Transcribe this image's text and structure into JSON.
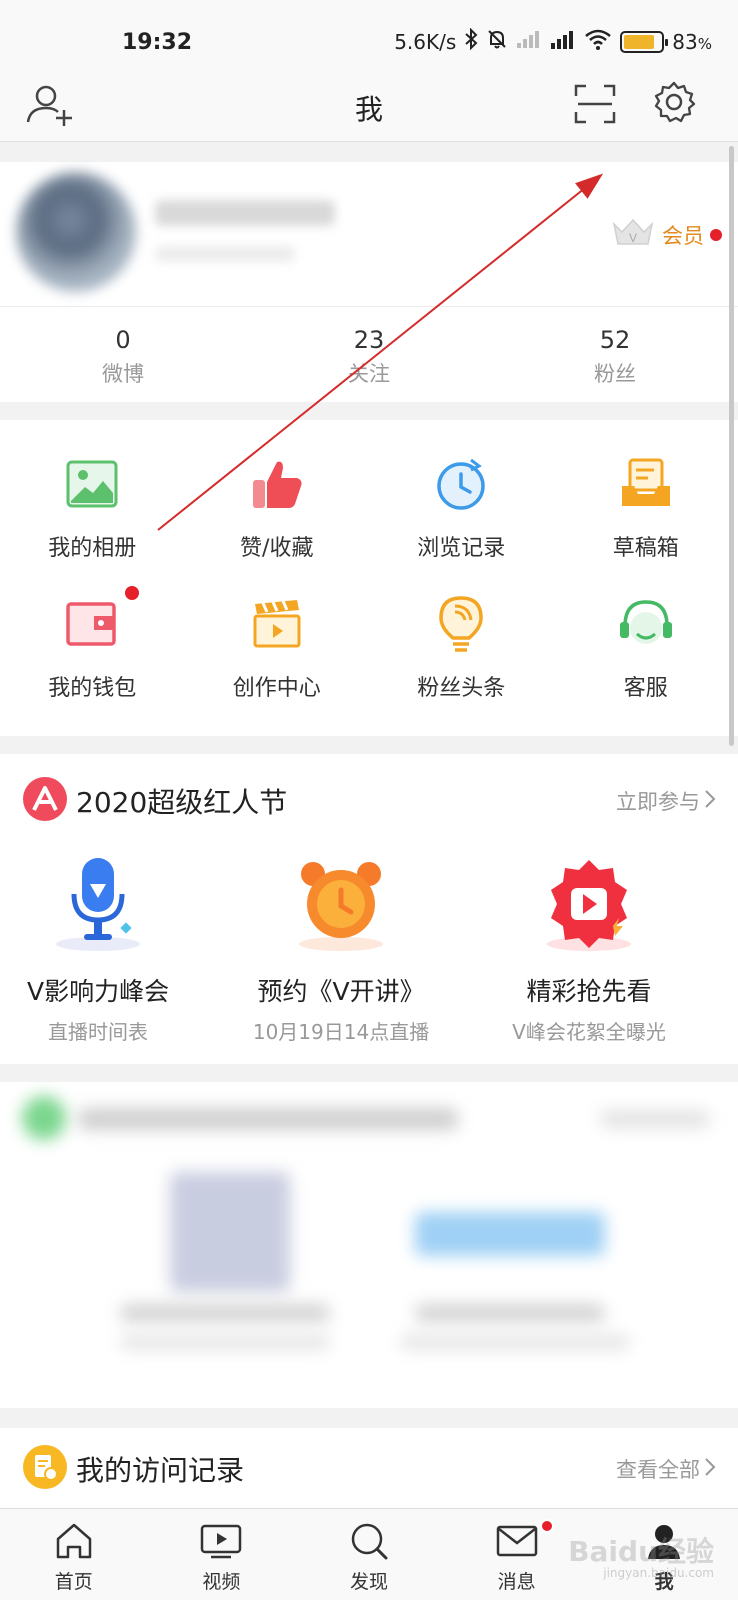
{
  "status_bar": {
    "time": "19:32",
    "net_speed": "5.6K/s",
    "battery_percent": "83",
    "battery_level": 0.83,
    "battery_unit": "%"
  },
  "nav": {
    "title": "我"
  },
  "profile": {
    "vip_label": "会员",
    "stats": [
      {
        "value": "0",
        "label": "微博"
      },
      {
        "value": "23",
        "label": "关注"
      },
      {
        "value": "52",
        "label": "粉丝"
      }
    ]
  },
  "grid": {
    "items": [
      {
        "label": "我的相册",
        "icon": "album-icon"
      },
      {
        "label": "赞/收藏",
        "icon": "thumbs-up-icon"
      },
      {
        "label": "浏览记录",
        "icon": "history-clock-icon"
      },
      {
        "label": "草稿箱",
        "icon": "drafts-icon"
      },
      {
        "label": "我的钱包",
        "icon": "wallet-icon"
      },
      {
        "label": "创作中心",
        "icon": "clapperboard-icon"
      },
      {
        "label": "粉丝头条",
        "icon": "bulb-icon"
      },
      {
        "label": "客服",
        "icon": "headset-icon"
      }
    ]
  },
  "festival": {
    "title": "2020超级红人节",
    "link": "立即参与",
    "items": [
      {
        "title": "V影响力峰会",
        "sub": "直播时间表"
      },
      {
        "title": "预约《V开讲》",
        "sub": "10月19日14点直播"
      },
      {
        "title": "精彩抢先看",
        "sub": "V峰会花絮全曝光"
      }
    ]
  },
  "visits": {
    "title": "我的访问记录",
    "link": "查看全部"
  },
  "tabbar": {
    "tabs": [
      {
        "label": "首页"
      },
      {
        "label": "视频"
      },
      {
        "label": "发现"
      },
      {
        "label": "消息"
      },
      {
        "label": "我"
      }
    ]
  },
  "watermark": {
    "brand": "Baidu经验",
    "url": "jingyan.baidu.com"
  },
  "colors": {
    "accent_red": "#e6202a",
    "vip_orange": "#e38a1e",
    "annotation_arrow": "#d42a2a"
  }
}
